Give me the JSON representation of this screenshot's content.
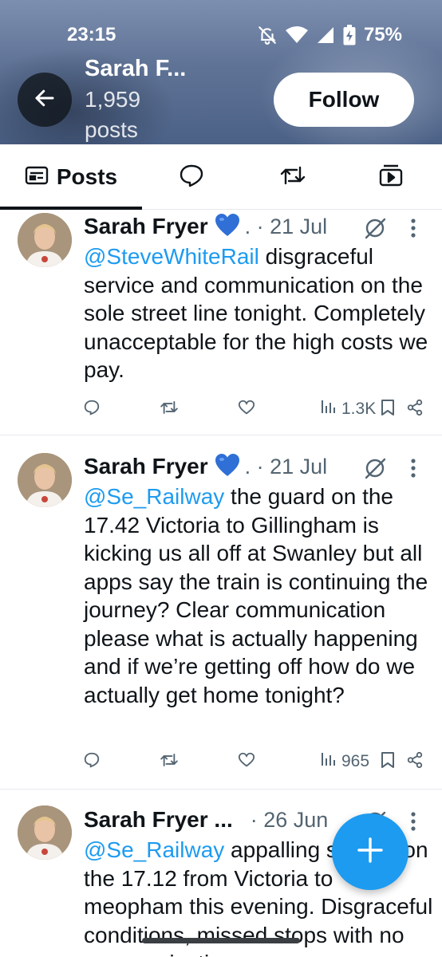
{
  "status_bar": {
    "time": "23:15",
    "battery": "75%"
  },
  "profile": {
    "name": "Sarah F...",
    "post_count": "1,959 posts",
    "follow_label": "Follow"
  },
  "tabs": {
    "posts_label": "Posts"
  },
  "tweets": [
    {
      "author": "Sarah Fryer",
      "emoji": "💙",
      "date": ". · 21 Jul",
      "mention": "@SteveWhiteRail",
      "text": " disgraceful service and communication on the sole street line tonight. Completely unacceptable for the high costs we pay.",
      "views": "1.3K"
    },
    {
      "author": "Sarah Fryer",
      "emoji": "💙",
      "date": ". · 21 Jul",
      "mention": "@Se_Railway",
      "text": " the guard on the 17.42 Victoria to Gillingham is kicking us all off at Swanley but all apps say the train is continuing the journey? Clear communication please what is actually happening and if we’re getting off how do we actually get home tonight?",
      "views": "965"
    },
    {
      "author": "Sarah Fryer ...",
      "date": "· 26 Jun",
      "mention": "@Se_Railway",
      "text": " appalling service on the 17.12 from Victoria to meopham this evening. Disgraceful conditions, missed stops with no communication"
    }
  ],
  "colors": {
    "accent": "#1d9bf0",
    "text": "#0f1419",
    "muted": "#536471"
  },
  "icons": {
    "header": [
      "back-arrow-icon",
      "bell-off-icon",
      "wifi-icon",
      "signal-icon",
      "battery-icon"
    ],
    "tabs": [
      "posts-icon",
      "replies-icon",
      "reposts-icon",
      "media-icon"
    ],
    "actions": [
      "reply-icon",
      "repost-icon",
      "like-icon",
      "views-icon",
      "bookmark-icon",
      "share-icon"
    ],
    "fab": "plus-icon"
  }
}
